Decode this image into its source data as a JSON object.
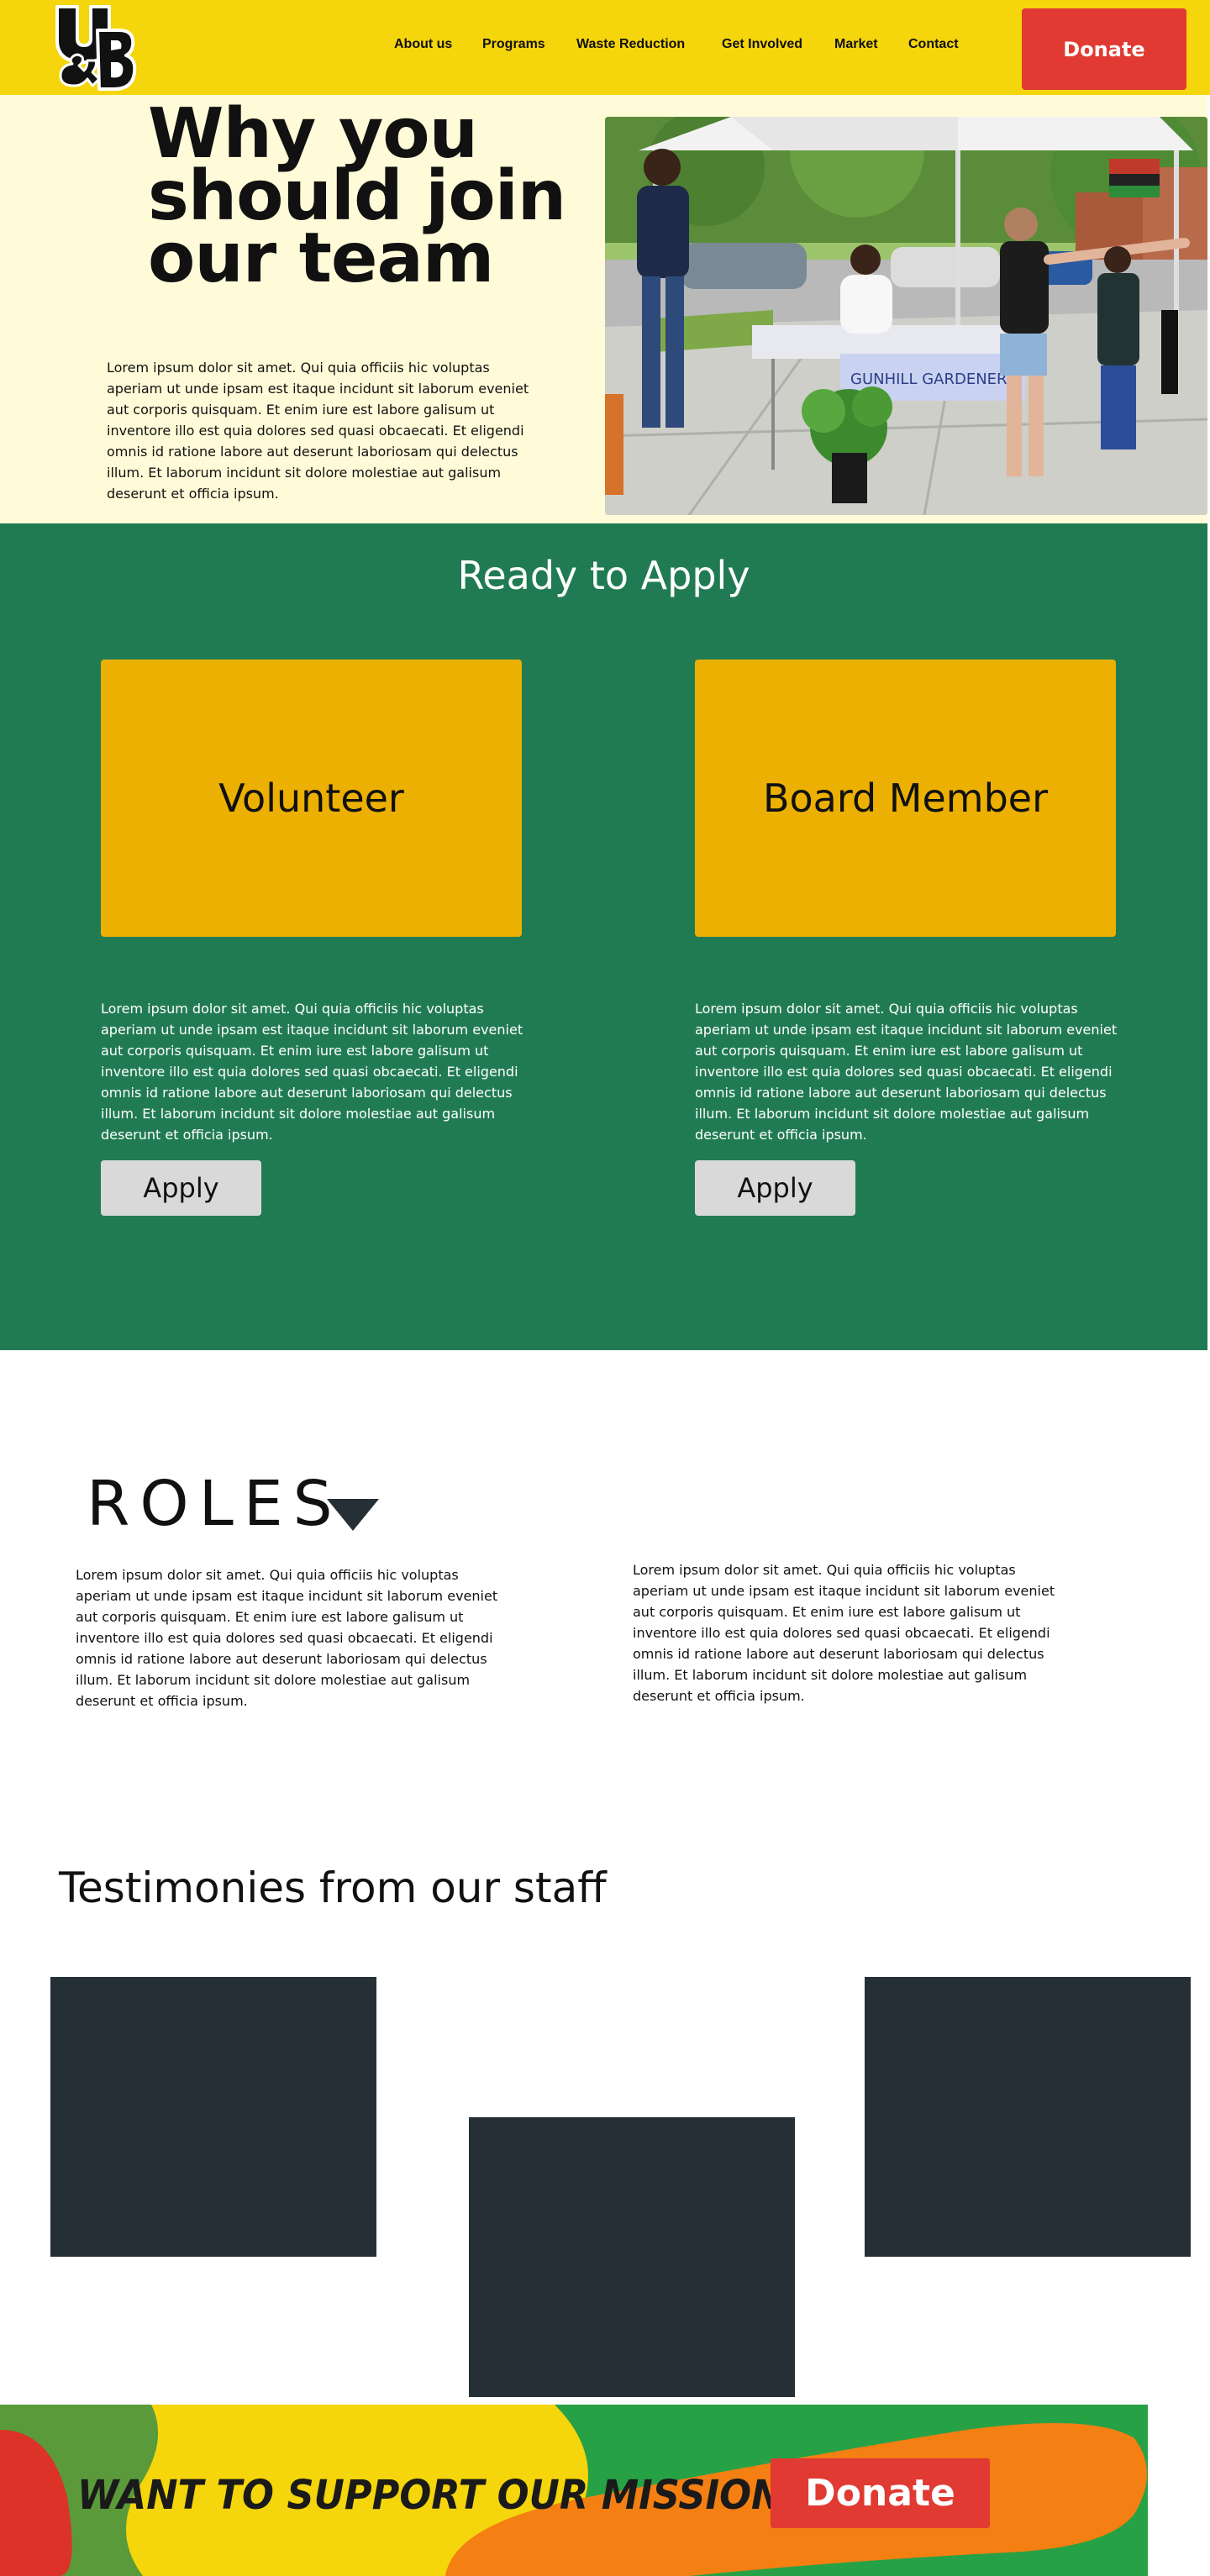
{
  "header": {
    "logo_alt": "U&B",
    "nav": [
      {
        "label": "About us"
      },
      {
        "label": "Programs"
      },
      {
        "label": "Waste Reduction"
      },
      {
        "label": "Get Involved"
      },
      {
        "label": "Market"
      },
      {
        "label": "Contact"
      }
    ],
    "donate_label": "Donate"
  },
  "hero": {
    "title": "Why you should join our team",
    "body": "Lorem ipsum dolor sit amet. Qui quia officiis hic voluptas aperiam ut unde ipsam est itaque incidunt sit laborum eveniet aut corporis quisquam. Et enim iure est labore galisum ut inventore illo est quia dolores sed quasi obcaecati. Et eligendi omnis id ratione labore aut deserunt laboriosam qui delectus illum. Et laborum incidunt sit dolore molestiae aut galisum deserunt et officia ipsum.",
    "photo_banner_text": "GUNHILL GARDENERS"
  },
  "apply": {
    "title": "Ready to Apply",
    "cards": [
      {
        "label": "Volunteer",
        "body": "Lorem ipsum dolor sit amet. Qui quia officiis hic voluptas aperiam ut unde ipsam est itaque incidunt sit laborum eveniet aut corporis quisquam. Et enim iure est labore galisum ut inventore illo est quia dolores sed quasi obcaecati. Et eligendi omnis id ratione labore aut deserunt laboriosam qui delectus illum. Et laborum incidunt sit dolore molestiae aut galisum deserunt et officia ipsum.",
        "button": "Apply"
      },
      {
        "label": "Board Member",
        "body": "Lorem ipsum dolor sit amet. Qui quia officiis hic voluptas aperiam ut unde ipsam est itaque incidunt sit laborum eveniet aut corporis quisquam. Et enim iure est labore galisum ut inventore illo est quia dolores sed quasi obcaecati. Et eligendi omnis id ratione labore aut deserunt laboriosam qui delectus illum. Et laborum incidunt sit dolore molestiae aut galisum deserunt et officia ipsum.",
        "button": "Apply"
      }
    ]
  },
  "roles": {
    "title": "ROLES",
    "left_body": "Lorem ipsum dolor sit amet. Qui quia officiis hic voluptas aperiam ut unde ipsam est itaque incidunt sit laborum eveniet aut corporis quisquam. Et enim iure est labore galisum ut inventore illo est quia dolores sed quasi obcaecati. Et eligendi omnis id ratione labore aut deserunt laboriosam qui delectus illum. Et laborum incidunt sit dolore molestiae aut galisum deserunt et officia ipsum.",
    "right_body": "Lorem ipsum dolor sit amet. Qui quia officiis hic voluptas aperiam ut unde ipsam est itaque incidunt sit laborum eveniet aut corporis quisquam. Et enim iure est labore galisum ut inventore illo est quia dolores sed quasi obcaecati. Et eligendi omnis id ratione labore aut deserunt laboriosam qui delectus illum. Et laborum incidunt sit dolore molestiae aut galisum deserunt et officia ipsum."
  },
  "testimonies": {
    "title": "Testimonies from our staff"
  },
  "banner": {
    "title": "WANT TO SUPPORT OUR MISSION?",
    "donate_label": "Donate"
  },
  "colors": {
    "header_yellow": "#f5d50b",
    "hero_cream": "#fffbd8",
    "apply_green": "#217b52",
    "card_gold": "#ecb003",
    "donate_red": "#e03a33",
    "dark_slate": "#252f36"
  }
}
